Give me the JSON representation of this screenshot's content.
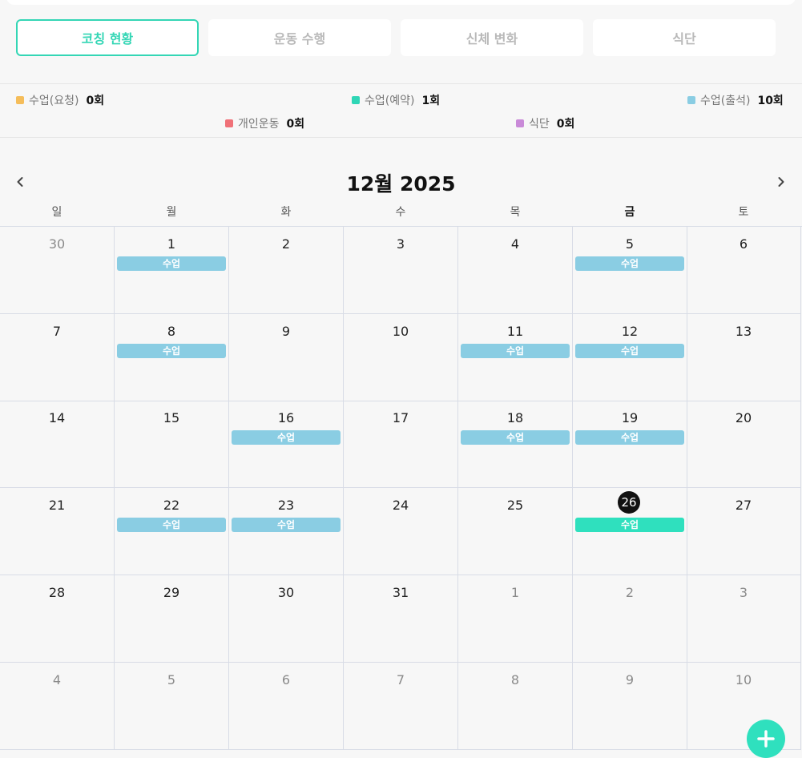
{
  "tabs": [
    {
      "label": "코칭 현황",
      "active": true
    },
    {
      "label": "운동 수행",
      "active": false
    },
    {
      "label": "신체 변화",
      "active": false
    },
    {
      "label": "식단",
      "active": false
    }
  ],
  "legend": [
    {
      "label": "수업(요청)",
      "count": "0회",
      "color": "#f5bd5a"
    },
    {
      "label": "수업(예약)",
      "count": "1회",
      "color": "#2fd6b6"
    },
    {
      "label": "수업(출석)",
      "count": "10회",
      "color": "#8acde3"
    },
    {
      "label": "개인운동",
      "count": "0회",
      "color": "#f07178"
    },
    {
      "label": "식단",
      "count": "0회",
      "color": "#c98ad8"
    }
  ],
  "calendar": {
    "title": "12월 2025",
    "prev_icon": "chevron-left-icon",
    "next_icon": "chevron-right-icon",
    "weekdays": [
      "일",
      "월",
      "화",
      "수",
      "목",
      "금",
      "토"
    ],
    "today_weekday_index": 5,
    "weeks": [
      [
        {
          "day": "30",
          "other": true
        },
        {
          "day": "1",
          "event": "수업",
          "type": "attended"
        },
        {
          "day": "2"
        },
        {
          "day": "3"
        },
        {
          "day": "4"
        },
        {
          "day": "5",
          "event": "수업",
          "type": "attended"
        },
        {
          "day": "6"
        }
      ],
      [
        {
          "day": "7"
        },
        {
          "day": "8",
          "event": "수업",
          "type": "attended"
        },
        {
          "day": "9"
        },
        {
          "day": "10"
        },
        {
          "day": "11",
          "event": "수업",
          "type": "attended"
        },
        {
          "day": "12",
          "event": "수업",
          "type": "attended"
        },
        {
          "day": "13"
        }
      ],
      [
        {
          "day": "14"
        },
        {
          "day": "15"
        },
        {
          "day": "16",
          "event": "수업",
          "type": "attended"
        },
        {
          "day": "17"
        },
        {
          "day": "18",
          "event": "수업",
          "type": "attended"
        },
        {
          "day": "19",
          "event": "수업",
          "type": "attended"
        },
        {
          "day": "20"
        }
      ],
      [
        {
          "day": "21"
        },
        {
          "day": "22",
          "event": "수업",
          "type": "attended"
        },
        {
          "day": "23",
          "event": "수업",
          "type": "attended"
        },
        {
          "day": "24"
        },
        {
          "day": "25"
        },
        {
          "day": "26",
          "today": true,
          "event": "수업",
          "type": "reserved"
        },
        {
          "day": "27"
        }
      ],
      [
        {
          "day": "28"
        },
        {
          "day": "29"
        },
        {
          "day": "30"
        },
        {
          "day": "31"
        },
        {
          "day": "1",
          "other": true
        },
        {
          "day": "2",
          "other": true
        },
        {
          "day": "3",
          "other": true
        }
      ],
      [
        {
          "day": "4",
          "other": true
        },
        {
          "day": "5",
          "other": true
        },
        {
          "day": "6",
          "other": true
        },
        {
          "day": "7",
          "other": true
        },
        {
          "day": "8",
          "other": true
        },
        {
          "day": "9",
          "other": true
        },
        {
          "day": "10",
          "other": true
        }
      ]
    ]
  },
  "fab": {
    "icon": "plus-icon"
  }
}
